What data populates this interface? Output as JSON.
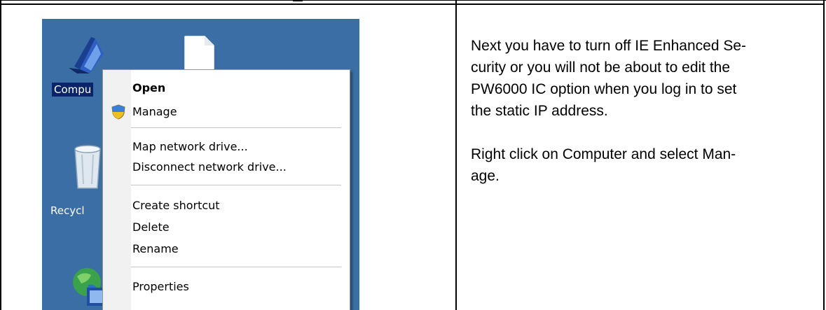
{
  "desktop": {
    "icons": [
      {
        "name": "computer-icon",
        "label": "Compu"
      },
      {
        "name": "file-icon",
        "label": ""
      },
      {
        "name": "recycle-bin-icon",
        "label": "Recycl"
      },
      {
        "name": "network-icon",
        "label": ""
      }
    ],
    "colors": {
      "background": "#3b6ea5",
      "selection": "#0a246a"
    }
  },
  "context_menu": {
    "items": [
      {
        "label": "Open",
        "bold": true
      },
      {
        "label": "Manage",
        "icon": "uac-shield-icon"
      },
      {
        "label": "Map network drive..."
      },
      {
        "label": "Disconnect network drive..."
      },
      {
        "label": "Create shortcut"
      },
      {
        "label": "Delete"
      },
      {
        "label": "Rename"
      },
      {
        "label": "Properties"
      }
    ]
  },
  "instructions": {
    "paragraph1": "Next you have to turn off IE Enhanced Se-curity or you will not be about to edit the PW6000 IC option when you log in to set the static IP address.",
    "paragraph2_lines": [
      "Right click on Computer and select Man-",
      "age."
    ],
    "paragraph1_lines": [
      "Next you have to turn off IE Enhanced Se-",
      "curity or you will not be about to edit the",
      "PW6000 IC option when you log in to set",
      "the static IP address."
    ]
  }
}
